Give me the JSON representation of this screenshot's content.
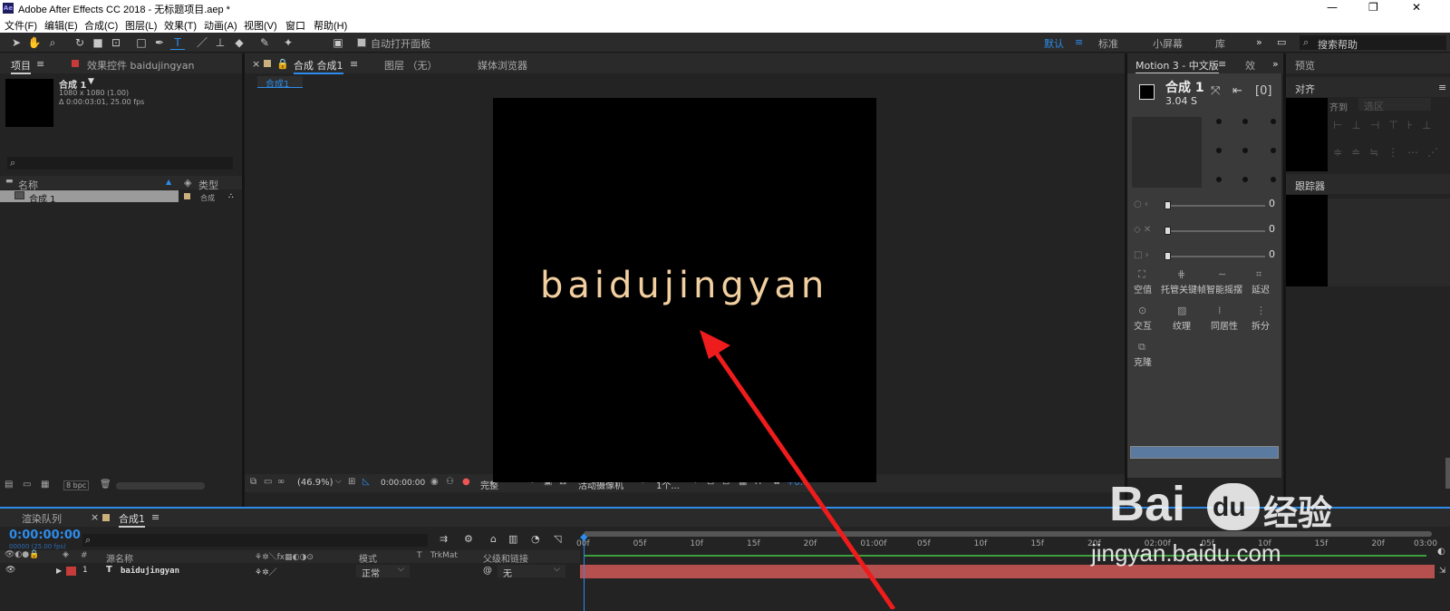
{
  "app": {
    "logo": "Ae",
    "title": "Adobe After Effects CC 2018 - 无标题项目.aep *",
    "window_controls": {
      "minimize": "—",
      "maximize": "❐",
      "close": "✕"
    }
  },
  "menu": [
    "文件(F)",
    "编辑(E)",
    "合成(C)",
    "图层(L)",
    "效果(T)",
    "动画(A)",
    "视图(V)",
    "窗口",
    "帮助(H)"
  ],
  "toolbar": {
    "auto_open_label": "自动打开面板",
    "workspaces": [
      "默认",
      "标准",
      "小屏幕",
      "库"
    ],
    "more": "»",
    "search_placeholder": "搜索帮助"
  },
  "project_panel": {
    "tab_project": "项目",
    "tab_effects": "效果控件 baidujingyan",
    "comp_name": "合成 1",
    "comp_size": "1080 x 1080 (1.00)",
    "comp_duration": "Δ 0:00:03:01, 25.00 fps",
    "search_glyph": "⌕",
    "col_name": "名称",
    "col_type": "类型",
    "items": [
      {
        "name": "合成 1",
        "type": "合成"
      }
    ],
    "bpc": "8 bpc"
  },
  "viewer": {
    "tab_close": "×",
    "tab_comp": "合成 合成1",
    "tab_layer": "图层 （无）",
    "tab_media": "媒体浏览器",
    "breadcrumb": "合成1",
    "canvas_text": "baidujingyan",
    "zoom": "(46.9%)",
    "timecode": "0:00:00:00",
    "resolution": "完整",
    "camera": "活动摄像机",
    "views": "1个...",
    "exposure": "+0.0"
  },
  "motion_panel": {
    "tab": "Motion 3 - 中文版",
    "tab2": "效",
    "comp_title": "合成 1",
    "comp_time": "3.04 S",
    "slider_values": [
      "0",
      "0",
      "0"
    ],
    "tools_row1": [
      "空值",
      "托管关键帧",
      "智能摇摆",
      "延迟"
    ],
    "tools_row2": [
      "交互",
      "纹理",
      "同居性",
      "拆分"
    ],
    "tools_row3": [
      "克隆"
    ]
  },
  "right_panels": {
    "preview": "预览",
    "align": "对齐",
    "align_to": "齐到",
    "align_target": "选区",
    "tracker": "跟踪器"
  },
  "timeline": {
    "tab_render": "渲染队列",
    "tab_comp": "合成1",
    "timecode": "0:00:00:00",
    "fps": "00000 (25.00 fps)",
    "col_source": "源名称",
    "col_mode": "模式",
    "col_t": "T",
    "col_trkmat": "TrkMat",
    "col_parent": "父级和链接",
    "layer": {
      "index": "1",
      "type_glyph": "T",
      "name": "baidujingyan",
      "mode": "正常",
      "parent": "无"
    },
    "ruler": [
      "00f",
      "05f",
      "10f",
      "15f",
      "20f",
      "01:00f",
      "05f",
      "10f",
      "15f",
      "20f",
      "02:00f",
      "05f",
      "10f",
      "15f",
      "20f",
      "03:00"
    ]
  },
  "watermark": {
    "brand": "Bai",
    "du": "du",
    "suffix": "经验",
    "url": "jingyan.baidu.com"
  },
  "colors": {
    "accent": "#2d8ceb",
    "layer_bar": "#b6504f",
    "canvas_text": "#f2cfa0",
    "arrow": "#ee1c1c"
  }
}
